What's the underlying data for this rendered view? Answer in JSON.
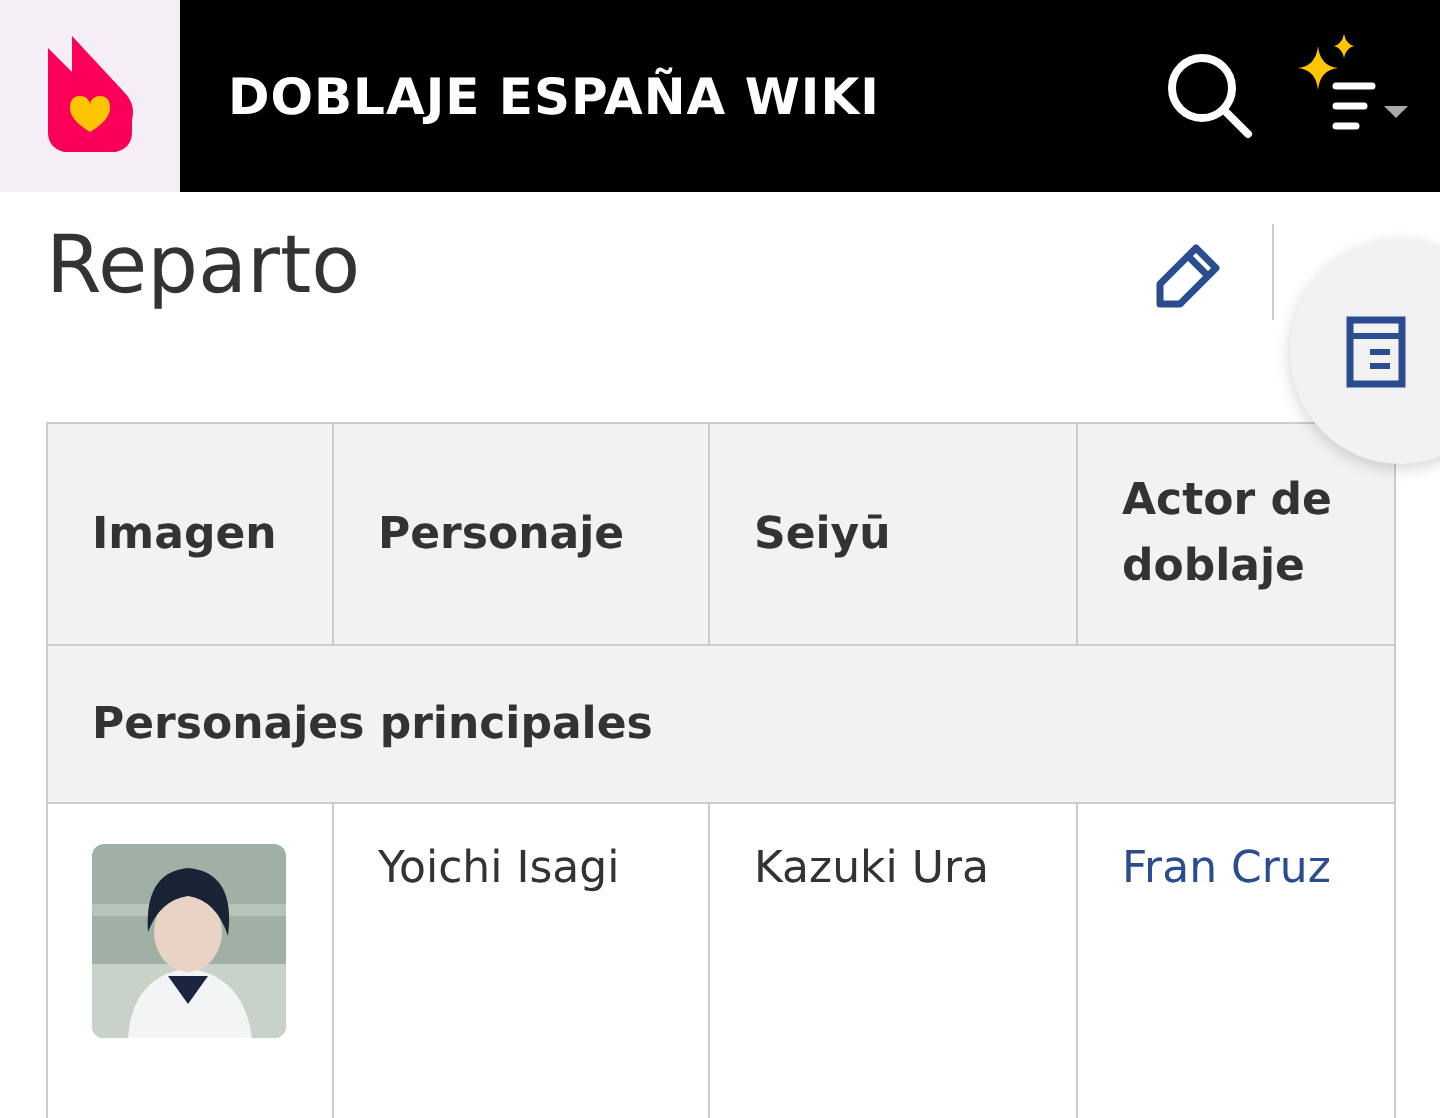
{
  "header": {
    "title": "DOBLAJE ESPAÑA WIKI"
  },
  "page": {
    "heading": "Reparto"
  },
  "table": {
    "columns": [
      "Imagen",
      "Personaje",
      "Seiyū",
      "Actor de doblaje"
    ],
    "sections": [
      {
        "title": "Personajes principales",
        "rows": [
          {
            "character": "Yoichi Isagi",
            "seiyu": "Kazuki Ura",
            "actor": "Fran Cruz"
          }
        ]
      }
    ]
  }
}
